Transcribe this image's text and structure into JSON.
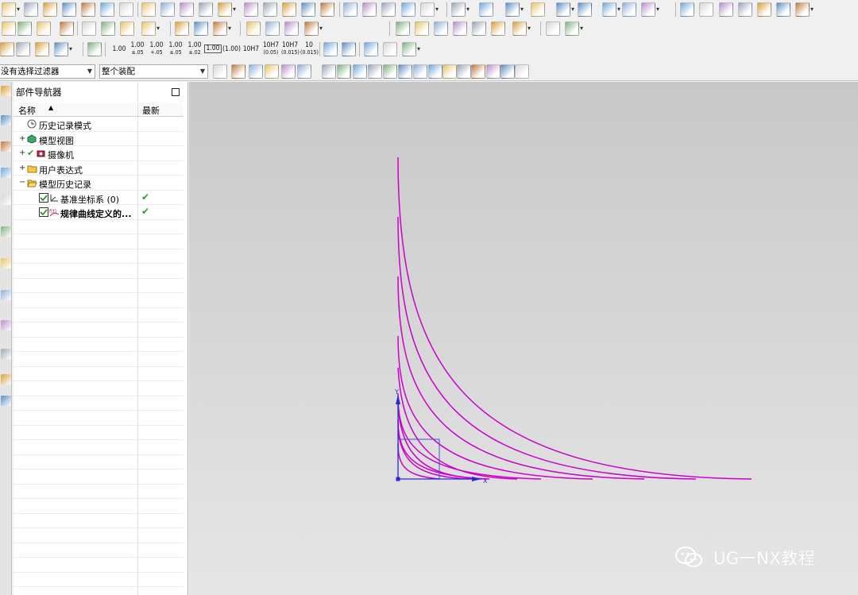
{
  "toolbar": {
    "dimension_buttons": [
      {
        "top": "1.00",
        "bottom": ""
      },
      {
        "top": "1.00",
        "bottom": "±.05"
      },
      {
        "top": "1.00",
        "bottom": "+.05"
      },
      {
        "top": "1.00",
        "bottom": "±.05"
      },
      {
        "top": "1.00",
        "bottom": "±.02"
      },
      {
        "top": "1.00",
        "bottom": ""
      },
      {
        "top": "(1.00)",
        "bottom": ""
      },
      {
        "top": "10H7",
        "bottom": ""
      },
      {
        "top": "10H7",
        "bottom": "(0.05)"
      },
      {
        "top": "10H7",
        "bottom": "(0.015)"
      },
      {
        "top": "10",
        "bottom": "(0.015)"
      }
    ],
    "fit_label": "10H7"
  },
  "filter_bar": {
    "filter_value": "没有选择过滤器",
    "scope_value": "整个装配"
  },
  "navigator": {
    "title": "部件导航器",
    "col_name": "名称",
    "col_latest": "最新",
    "items": [
      {
        "label": "历史记录模式",
        "expand": "",
        "checked": ""
      },
      {
        "label": "模型视图",
        "expand": "+",
        "checked": ""
      },
      {
        "label": "摄像机",
        "expand": "+",
        "checked": ""
      },
      {
        "label": "用户表达式",
        "expand": "+",
        "checked": ""
      },
      {
        "label": "模型历史记录",
        "expand": "−",
        "checked": ""
      },
      {
        "label": "基准坐标系 (0)",
        "expand": "",
        "checked": "✔"
      },
      {
        "label": "规律曲线定义的...",
        "expand": "",
        "checked": "✔"
      }
    ]
  },
  "viewport": {
    "axis_y_label": "Y",
    "axis_x_label": "X",
    "curve_color": "#cc00cc",
    "background_top": "#c8c8c8",
    "background_bottom": "#e6e6e6"
  },
  "watermark": {
    "text": "UG一NX教程"
  },
  "colors": {
    "check_green": "#2a9d2a",
    "axis_blue": "#2a2ad0"
  }
}
